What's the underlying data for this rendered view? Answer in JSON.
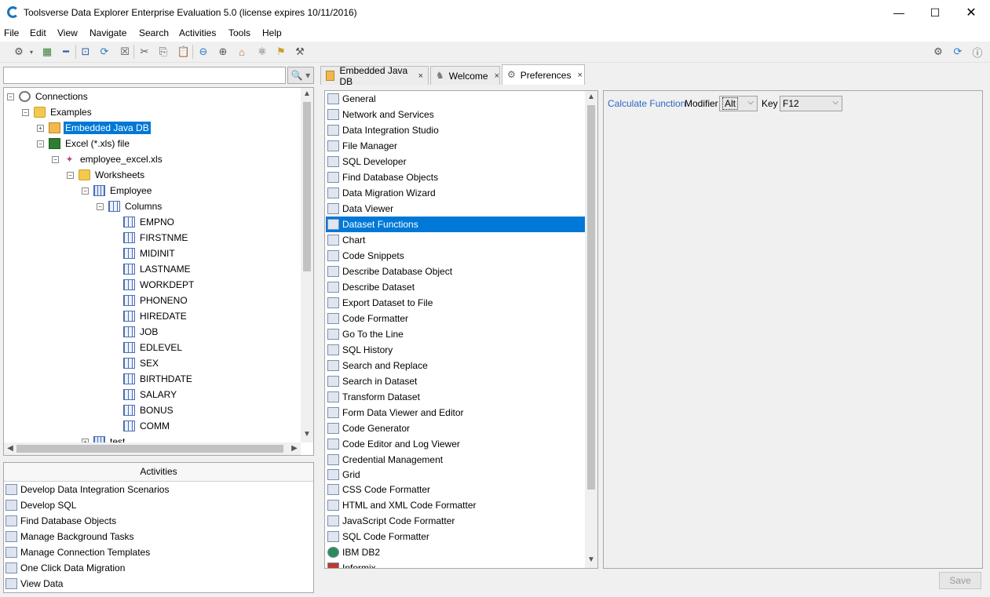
{
  "window": {
    "title": "Toolsverse Data Explorer Enterprise Evaluation 5.0 (license expires 10/11/2016)"
  },
  "menu": [
    "File",
    "Edit",
    "View",
    "Navigate",
    "Search",
    "Activities",
    "Tools",
    "Help"
  ],
  "search": {
    "value": "",
    "button": "🔍 ▾"
  },
  "tree": [
    {
      "label": "Connections",
      "expander": "−"
    },
    {
      "label": "Examples",
      "expander": "−"
    },
    {
      "label": "Embedded Java DB",
      "expander": "+"
    },
    {
      "label": "Excel (*.xls) file",
      "expander": "−"
    },
    {
      "label": "employee_excel.xls",
      "expander": "−"
    },
    {
      "label": "Worksheets",
      "expander": "−"
    },
    {
      "label": "Employee",
      "expander": "−"
    },
    {
      "label": "Columns",
      "expander": "−"
    },
    {
      "label": "EMPNO"
    },
    {
      "label": "FIRSTNME"
    },
    {
      "label": "MIDINIT"
    },
    {
      "label": "LASTNAME"
    },
    {
      "label": "WORKDEPT"
    },
    {
      "label": "PHONENO"
    },
    {
      "label": "HIREDATE"
    },
    {
      "label": "JOB"
    },
    {
      "label": "EDLEVEL"
    },
    {
      "label": "SEX"
    },
    {
      "label": "BIRTHDATE"
    },
    {
      "label": "SALARY"
    },
    {
      "label": "BONUS"
    },
    {
      "label": "COMM"
    },
    {
      "label": "test",
      "expander": "+"
    }
  ],
  "activities": {
    "title": "Activities",
    "items": [
      "Develop Data Integration Scenarios",
      "Develop SQL",
      "Find Database Objects",
      "Manage Background Tasks",
      "Manage Connection Templates",
      "One Click Data Migration",
      "View Data"
    ]
  },
  "tabs": [
    {
      "label": "Embedded Java DB",
      "close": "×"
    },
    {
      "label": "Welcome",
      "close": "×"
    },
    {
      "label": "Preferences",
      "close": "×"
    }
  ],
  "preferences": {
    "items": [
      "General",
      "Network and Services",
      "Data Integration Studio",
      "File Manager",
      "SQL Developer",
      "Find Database Objects",
      "Data Migration Wizard",
      "Data Viewer",
      "Dataset Functions",
      "Chart",
      "Code Snippets",
      "Describe Database Object",
      "Describe Dataset",
      "Export Dataset to File",
      "Code Formatter",
      "Go To the Line",
      "SQL History",
      "Search and Replace",
      "Search in Dataset",
      "Transform Dataset",
      "Form Data Viewer and Editor",
      "Code Generator",
      "Code Editor and Log Viewer",
      "Credential Management",
      "Grid",
      "CSS Code Formatter",
      "HTML and XML Code Formatter",
      "JavaScript Code Formatter",
      "SQL Code Formatter",
      "IBM DB2",
      "Informix"
    ],
    "selected": "Dataset Functions"
  },
  "settings": {
    "function_link": "Calculate Function",
    "modifier_label": "Modifier",
    "modifier_value": "Alt",
    "key_label": "Key",
    "key_value": "F12",
    "save_label": "Save"
  },
  "colors": {
    "selection": "#0078d7",
    "link": "#2a67c7"
  }
}
